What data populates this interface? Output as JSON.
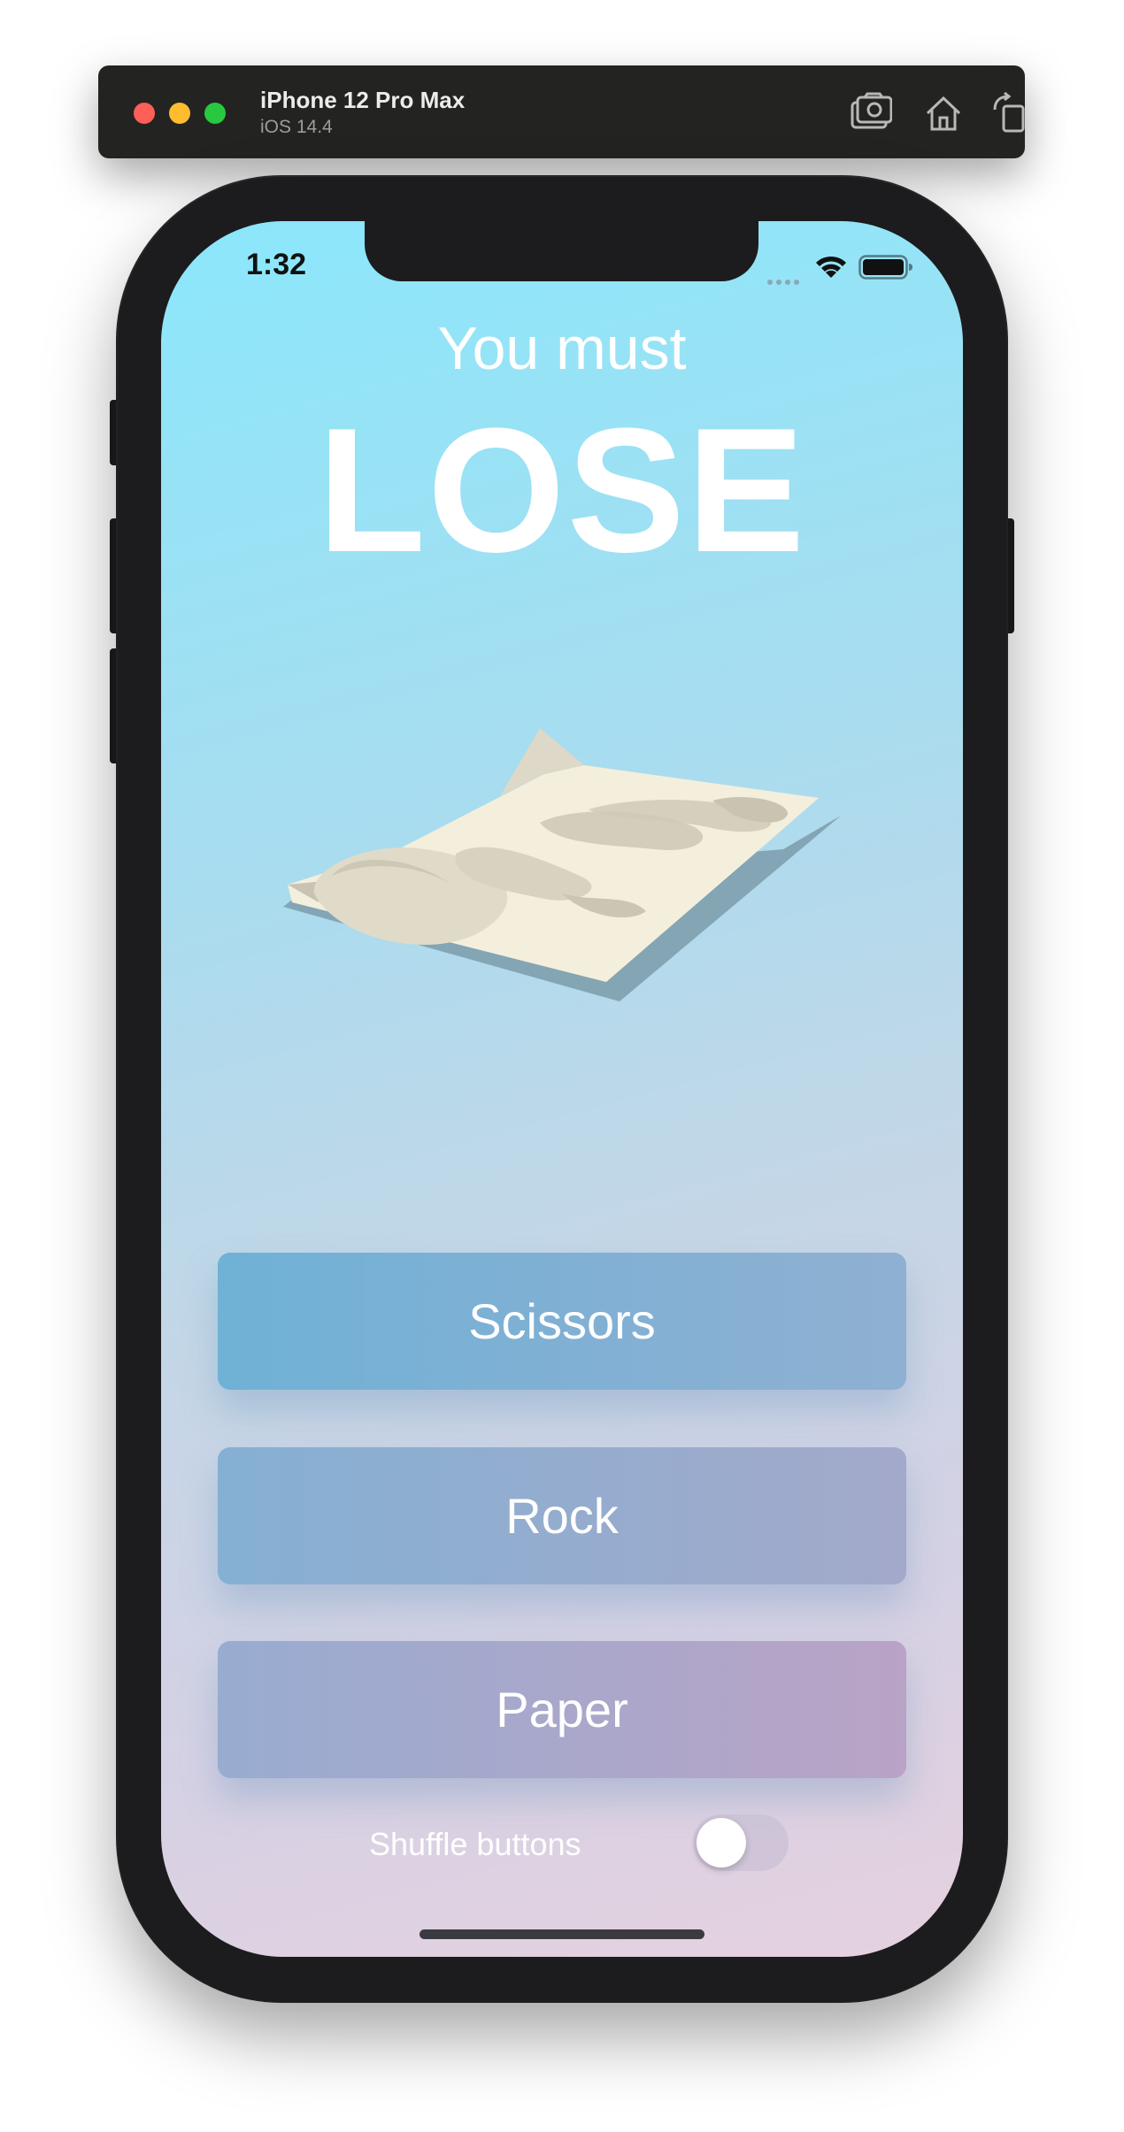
{
  "simulator": {
    "device_name": "iPhone 12 Pro Max",
    "os_version": "iOS 14.4",
    "icons": [
      "screenshot-icon",
      "home-icon",
      "rotate-icon"
    ]
  },
  "status_bar": {
    "time": "1:32",
    "icons": [
      "signal-dots-icon",
      "wifi-icon",
      "battery-icon"
    ]
  },
  "game": {
    "prompt": "You must",
    "goal": "LOSE",
    "current_choice_icon": "paper-icon",
    "choices": [
      {
        "label": "Scissors"
      },
      {
        "label": "Rock"
      },
      {
        "label": "Paper"
      }
    ],
    "shuffle": {
      "label": "Shuffle buttons",
      "enabled": false
    }
  },
  "colors": {
    "background_top": "#8be7fb",
    "background_bottom": "#e6d1df",
    "text": "#ffffff"
  }
}
